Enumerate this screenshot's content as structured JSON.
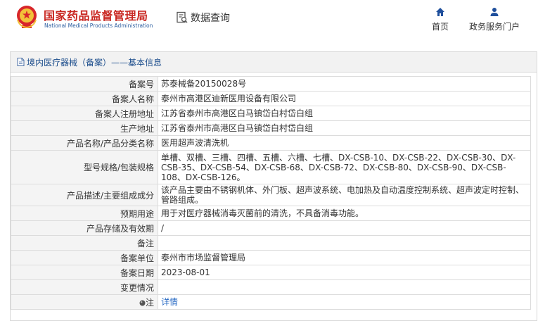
{
  "header": {
    "site_name_cn": "国家药品监督管理局",
    "site_name_en": "National Medical Products Administration",
    "query_label": "数据查询",
    "nav": {
      "home": "首页",
      "gov_portal": "政务服务门户"
    }
  },
  "breadcrumb": "境内医疗器械（备案）——基本信息",
  "rows": [
    {
      "label": "备案号",
      "value": "苏泰械备20150028号"
    },
    {
      "label": "备案人名称",
      "value": "泰州市高港区迪新医用设备有限公司"
    },
    {
      "label": "备案人注册地址",
      "value": "江苏省泰州市高港区白马镇岱白村岱白组"
    },
    {
      "label": "生产地址",
      "value": "江苏省泰州市高港区白马镇岱白村岱白组"
    },
    {
      "label": "产品名称/产品分类名称",
      "value": "医用超声波清洗机"
    },
    {
      "label": "型号规格/包装规格",
      "value": "单槽、双槽、三槽、四槽、五槽、六槽、七槽、DX-CSB-10、DX-CSB-22、DX-CSB-30、DX-CSB-35、DX-CSB-54、DX-CSB-68、DX-CSB-72、DX-CSB-80、DX-CSB-90、DX-CSB-108、DX-CSB-126。"
    },
    {
      "label": "产品描述/主要组成成分",
      "value": "该产品主要由不锈钢机体、外门板、超声波系统、电加热及自动温度控制系统、超声波定时控制、管路组成。"
    },
    {
      "label": "预期用途",
      "value": "用于对医疗器械消毒灭菌前的清洗，不具备消毒功能。"
    },
    {
      "label": "产品存储及有效期",
      "value": "/"
    },
    {
      "label": "备注",
      "value": ""
    },
    {
      "label": "备案单位",
      "value": "泰州市市场监督管理局"
    },
    {
      "label": "备案日期",
      "value": "2023-08-01"
    },
    {
      "label": "变更情况",
      "value": ""
    },
    {
      "label": "注",
      "value": "详情"
    }
  ],
  "colors": {
    "brand_red": "#c8251f",
    "brand_blue": "#2a5d9f",
    "link_blue": "#2b6cc4",
    "label_bg": "#f4f4f4"
  }
}
